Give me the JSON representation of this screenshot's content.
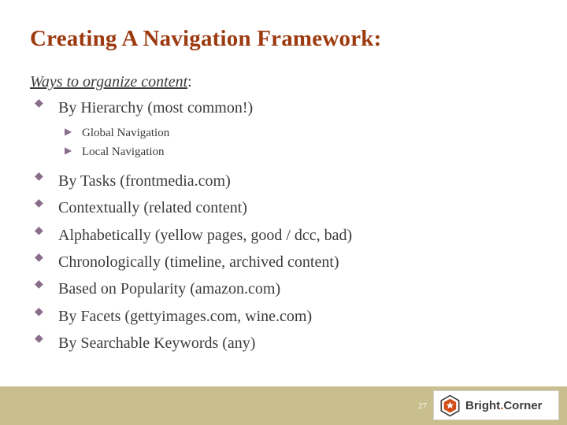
{
  "slide": {
    "title": "Creating A Navigation Framework:",
    "lead_underlined": "Ways to organize content",
    "lead_suffix": ":",
    "bullet_glyph": "◆",
    "subbullet_glyph": "▶",
    "items": [
      {
        "label": "By Hierarchy (most common!)",
        "children": [
          "Global Navigation",
          "Local Navigation"
        ]
      },
      {
        "label": "By Tasks (frontmedia.com)",
        "children": []
      },
      {
        "label": "Contextually (related content)",
        "children": []
      },
      {
        "label": "Alphabetically (yellow pages, good / dcc, bad)",
        "children": []
      },
      {
        "label": "Chronologically (timeline, archived content)",
        "children": []
      },
      {
        "label": "Based on Popularity (amazon.com)",
        "children": []
      },
      {
        "label": "By Facets (gettyimages.com, wine.com)",
        "children": []
      },
      {
        "label": "By Searchable Keywords (any)",
        "children": []
      }
    ]
  },
  "footer": {
    "slide_number": "27",
    "logo_text_1": "Bright",
    "logo_text_dot": ".",
    "logo_text_2": "Corner"
  },
  "colors": {
    "title": "#9c3a10",
    "bullet": "#8a6d8a",
    "footer_bar": "#c8be8e",
    "logo_accent": "#d14b16"
  }
}
